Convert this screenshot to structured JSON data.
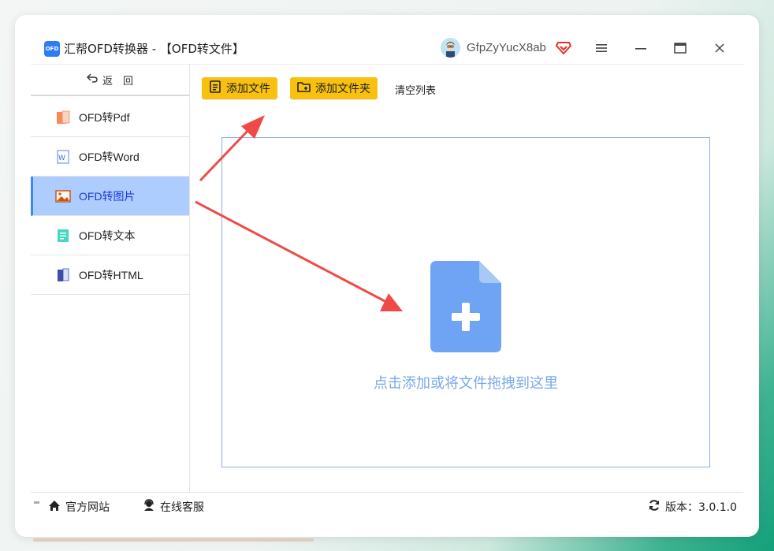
{
  "app": {
    "logo_text": "OFD",
    "title": "汇帮OFD转换器 - 【OFD转文件】",
    "username": "GfpZyYucX8ab"
  },
  "sidebar": {
    "back_label": "返　回",
    "items": [
      {
        "label": "OFD转Pdf",
        "icon": "pdf-file-icon",
        "active": false
      },
      {
        "label": "OFD转Word",
        "icon": "word-file-icon",
        "active": false
      },
      {
        "label": "OFD转图片",
        "icon": "image-icon",
        "active": true
      },
      {
        "label": "OFD转文本",
        "icon": "text-file-icon",
        "active": false
      },
      {
        "label": "OFD转HTML",
        "icon": "html-book-icon",
        "active": false
      }
    ]
  },
  "toolbar": {
    "add_file_label": "添加文件",
    "add_folder_label": "添加文件夹",
    "clear_label": "清空列表"
  },
  "dropzone": {
    "hint": "点击添加或将文件拖拽到这里"
  },
  "bottombar": {
    "website_label": "官方网站",
    "support_label": "在线客服",
    "version_label": "版本：3.0.1.0"
  },
  "colors": {
    "accent_yellow": "#f8c10f",
    "active_nav_bg": "#aecdff",
    "dropzone_icon": "#6ea4f3",
    "arrow_red": "#f04a48"
  }
}
